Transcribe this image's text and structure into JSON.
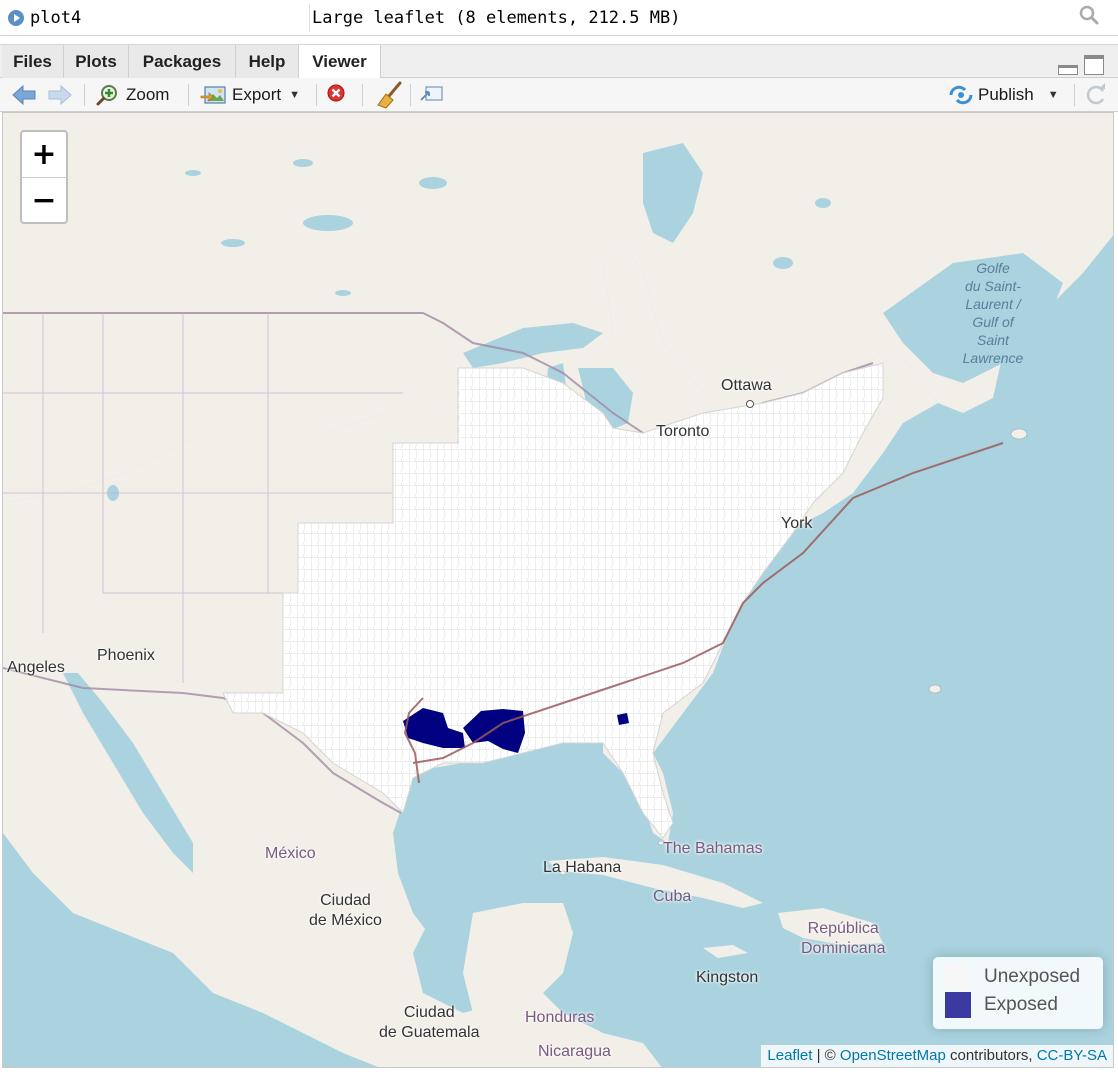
{
  "environment": {
    "object_name": "plot4",
    "object_value": "Large leaflet (8 elements, 212.5 MB)"
  },
  "tabs": [
    {
      "label": "Files",
      "active": false
    },
    {
      "label": "Plots",
      "active": false
    },
    {
      "label": "Packages",
      "active": false
    },
    {
      "label": "Help",
      "active": false
    },
    {
      "label": "Viewer",
      "active": true
    }
  ],
  "toolbar": {
    "zoom_label": "Zoom",
    "export_label": "Export",
    "publish_label": "Publish"
  },
  "map": {
    "zoom_in": "+",
    "zoom_out": "−",
    "labels": {
      "ottawa": "Ottawa",
      "toronto": "Toronto",
      "york": "York",
      "gulf_of_st_lawrence": [
        "Golfe",
        "du Saint-",
        "Laurent /",
        "Gulf of",
        "Saint",
        "Lawrence"
      ],
      "angeles": "Angeles",
      "phoenix": "Phoenix",
      "mexico": "México",
      "ciudad_de_mexico": [
        "Ciudad",
        "de México"
      ],
      "la_habana": "La Habana",
      "bahamas": "The Bahamas",
      "cuba": "Cuba",
      "republica_dominicana": [
        "República",
        "Dominicana"
      ],
      "kingston": "Kingston",
      "ciudad_de_guatemala": [
        "Ciudad",
        "de Guatemala"
      ],
      "honduras": "Honduras",
      "nicaragua": "Nicaragua"
    },
    "legend": [
      {
        "label": "Unexposed",
        "color": "#f7f7f7"
      },
      {
        "label": "Exposed",
        "color": "#3b3aa3"
      }
    ],
    "attribution": {
      "leaflet": "Leaflet",
      "separator": " | © ",
      "osm": "OpenStreetMap",
      "contributors": " contributors, ",
      "license": "CC-BY-SA"
    },
    "colors": {
      "water": "#aad3df",
      "land": "#f2efe9",
      "counties_fill": "#ffffff",
      "county_border": "#d4d4d4",
      "exposed_fill": "#000080",
      "storm_track": "#9c5a5a",
      "boundary": "#a18aa5"
    }
  }
}
